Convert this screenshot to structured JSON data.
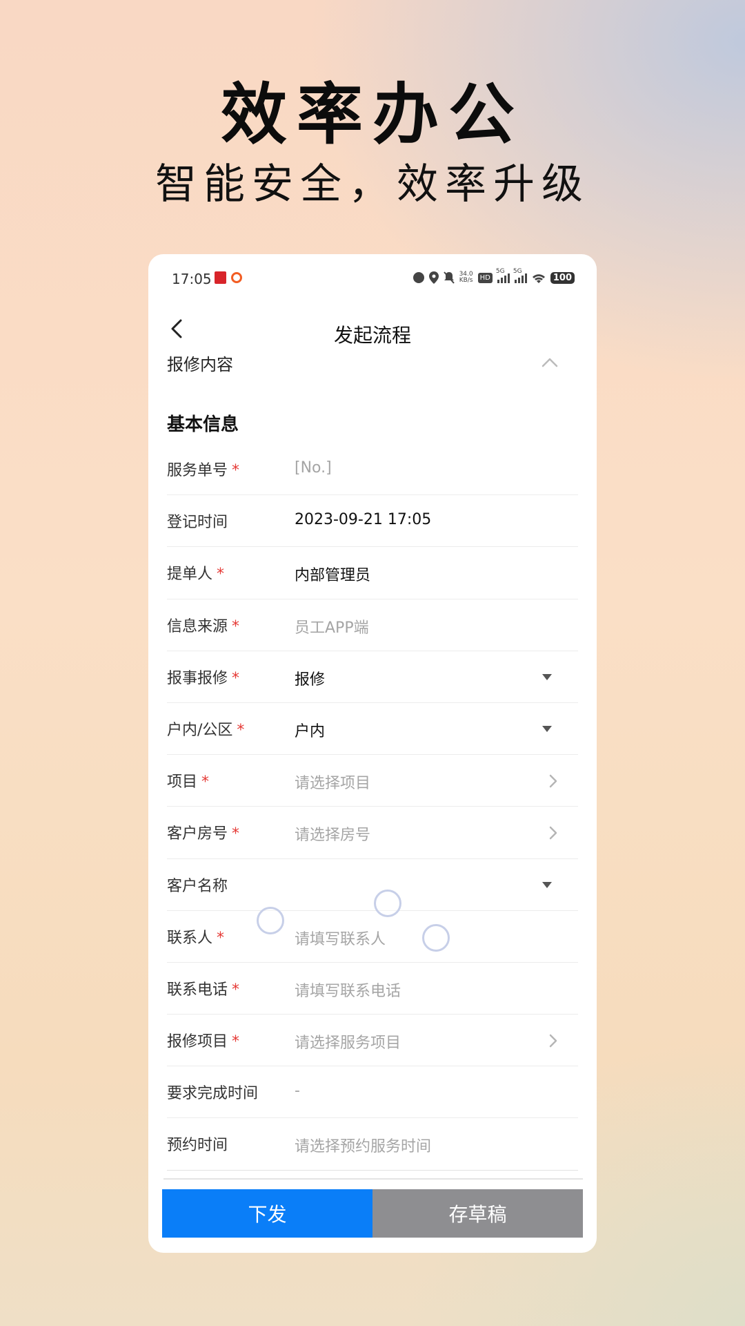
{
  "hero": {
    "title": "效率办公",
    "subtitle": "智能安全，效率升级"
  },
  "status_bar": {
    "time": "17:05",
    "speed": "34.0",
    "speed_unit": "KB/s",
    "hd": "HD",
    "network_1": "5G",
    "network_2": "5G",
    "battery": "100",
    "icons": [
      "alarm-icon",
      "location-icon",
      "mute-icon",
      "wifi-icon"
    ]
  },
  "nav": {
    "title": "发起流程",
    "back_icon": "chevron-left-icon"
  },
  "section": {
    "title": "报修内容",
    "toggle_icon": "chevron-up-icon",
    "group_title": "基本信息"
  },
  "form": {
    "rows": [
      {
        "label": "服务单号",
        "required": "*",
        "value": "[No.]",
        "placeholder": true,
        "accessory": "none"
      },
      {
        "label": "登记时间",
        "required": "",
        "value": "2023-09-21 17:05",
        "placeholder": false,
        "accessory": "none"
      },
      {
        "label": "提单人",
        "required": "*",
        "value": "内部管理员",
        "placeholder": false,
        "accessory": "none"
      },
      {
        "label": "信息来源",
        "required": "*",
        "value": "员工APP端",
        "placeholder": true,
        "accessory": "none"
      },
      {
        "label": "报事报修",
        "required": "*",
        "value": "报修",
        "placeholder": false,
        "accessory": "dropdown"
      },
      {
        "label": "户内/公区",
        "required": "*",
        "value": "户内",
        "placeholder": false,
        "accessory": "dropdown"
      },
      {
        "label": "项目",
        "required": "*",
        "value": "请选择项目",
        "placeholder": true,
        "accessory": "chevron"
      },
      {
        "label": "客户房号",
        "required": "*",
        "value": "请选择房号",
        "placeholder": true,
        "accessory": "chevron"
      },
      {
        "label": "客户名称",
        "required": "",
        "value": "",
        "placeholder": false,
        "accessory": "dropdown"
      },
      {
        "label": "联系人",
        "required": "*",
        "value": "请填写联系人",
        "placeholder": true,
        "accessory": "none"
      },
      {
        "label": "联系电话",
        "required": "*",
        "value": "请填写联系电话",
        "placeholder": true,
        "accessory": "none"
      },
      {
        "label": "报修项目",
        "required": "*",
        "value": "请选择服务项目",
        "placeholder": true,
        "accessory": "chevron"
      },
      {
        "label": "要求完成时间",
        "required": "",
        "value": "-",
        "placeholder": true,
        "accessory": "none"
      },
      {
        "label": "预约时间",
        "required": "",
        "value": "请选择预约服务时间",
        "placeholder": true,
        "accessory": "none"
      }
    ]
  },
  "footer": {
    "dispatch_label": "下发",
    "draft_label": "存草稿"
  },
  "colors": {
    "primary": "#0a7ef8",
    "secondary": "#8e8e91",
    "required": "#e53935",
    "placeholder": "#a5a5a5"
  }
}
